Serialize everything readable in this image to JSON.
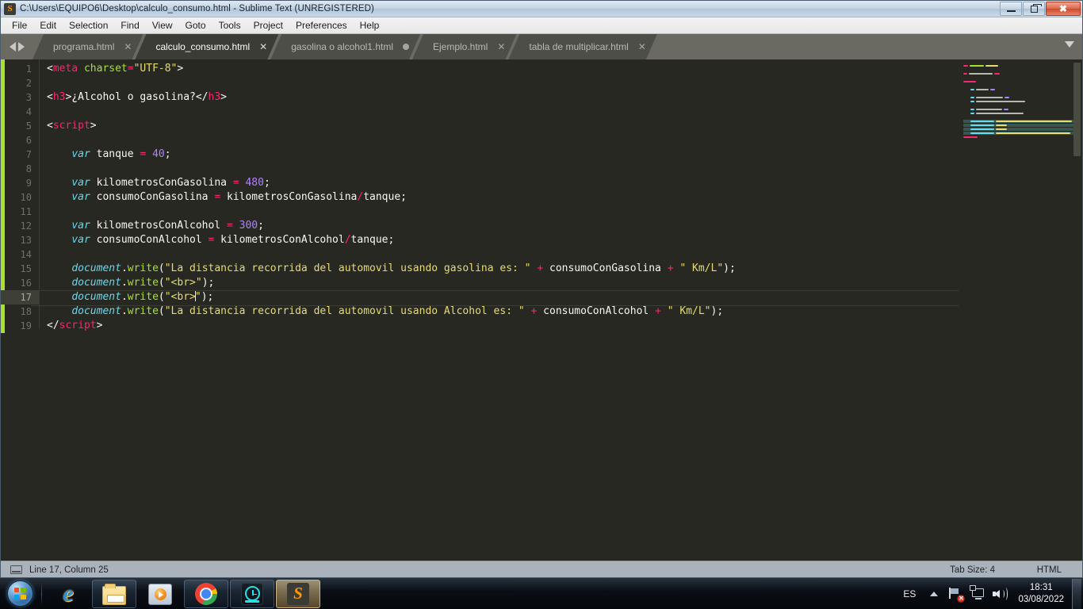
{
  "window": {
    "title": "C:\\Users\\EQUIPO6\\Desktop\\calculo_consumo.html - Sublime Text (UNREGISTERED)",
    "app_icon": "S",
    "controls": {
      "minimize": "minimize-icon",
      "maximize": "maximize-icon",
      "close": "✖"
    }
  },
  "menubar": {
    "items": [
      "File",
      "Edit",
      "Selection",
      "Find",
      "View",
      "Goto",
      "Tools",
      "Project",
      "Preferences",
      "Help"
    ]
  },
  "tabs": [
    {
      "label": "programa.html",
      "active": false,
      "dirty": false,
      "close": "✕"
    },
    {
      "label": "calculo_consumo.html",
      "active": true,
      "dirty": false,
      "close": "✕"
    },
    {
      "label": "gasolina o alcohol1.html",
      "active": false,
      "dirty": true,
      "close": "✕"
    },
    {
      "label": "Ejemplo.html",
      "active": false,
      "dirty": false,
      "close": "✕"
    },
    {
      "label": "tabla de multiplicar.html",
      "active": false,
      "dirty": false,
      "close": "✕"
    }
  ],
  "editor": {
    "current_line": 17,
    "line_numbers": [
      1,
      2,
      3,
      4,
      5,
      6,
      7,
      8,
      9,
      10,
      11,
      12,
      13,
      14,
      15,
      16,
      17,
      18,
      19
    ],
    "lines": [
      {
        "n": 1,
        "text": "<meta charset=\"UTF-8\">"
      },
      {
        "n": 2,
        "text": ""
      },
      {
        "n": 3,
        "text": "<h3>¿Alcohol o gasolina?</h3>"
      },
      {
        "n": 4,
        "text": ""
      },
      {
        "n": 5,
        "text": "<script>"
      },
      {
        "n": 6,
        "text": ""
      },
      {
        "n": 7,
        "text": "    var tanque = 40;"
      },
      {
        "n": 8,
        "text": ""
      },
      {
        "n": 9,
        "text": "    var kilometrosConGasolina = 480;"
      },
      {
        "n": 10,
        "text": "    var consumoConGasolina = kilometrosConGasolina/tanque;"
      },
      {
        "n": 11,
        "text": ""
      },
      {
        "n": 12,
        "text": "    var kilometrosConAlcohol = 300;"
      },
      {
        "n": 13,
        "text": "    var consumoConAlcohol = kilometrosConAlcohol/tanque;"
      },
      {
        "n": 14,
        "text": ""
      },
      {
        "n": 15,
        "text": "    document.write(\"La distancia recorrida del automovil usando gasolina es: \" + consumoConGasolina + \" Km/L\");"
      },
      {
        "n": 16,
        "text": "    document.write(\"<br>\");"
      },
      {
        "n": 17,
        "text": "    document.write(\"<br>\");"
      },
      {
        "n": 18,
        "text": "    document.write(\"La distancia recorrida del automovil usando Alcohol es: \" + consumoConAlcohol + \" Km/L\");"
      },
      {
        "n": 19,
        "text": "</script>"
      }
    ]
  },
  "statusbar": {
    "position": "Line 17, Column 25",
    "tab_size": "Tab Size: 4",
    "syntax": "HTML"
  },
  "taskbar": {
    "start": "start-orb",
    "items": [
      {
        "name": "internet-explorer",
        "glyph": "e"
      },
      {
        "name": "windows-explorer",
        "glyph": "folder"
      },
      {
        "name": "windows-media-player",
        "glyph": "play"
      },
      {
        "name": "google-chrome",
        "glyph": "chrome"
      },
      {
        "name": "clock-app",
        "glyph": "clock"
      },
      {
        "name": "sublime-text",
        "glyph": "S"
      }
    ],
    "tray": {
      "language": "ES",
      "time": "18:31",
      "date": "03/08/2022",
      "icons": [
        "network-error-icon",
        "monitor-icon",
        "volume-icon"
      ]
    }
  },
  "colors": {
    "editor_bg": "#272822",
    "accent_green": "#a6e22e",
    "tag": "#f92672",
    "string": "#e6db74",
    "keyword": "#66d9ef",
    "number": "#ae81ff",
    "statusbar_bg": "#aab2bc"
  }
}
